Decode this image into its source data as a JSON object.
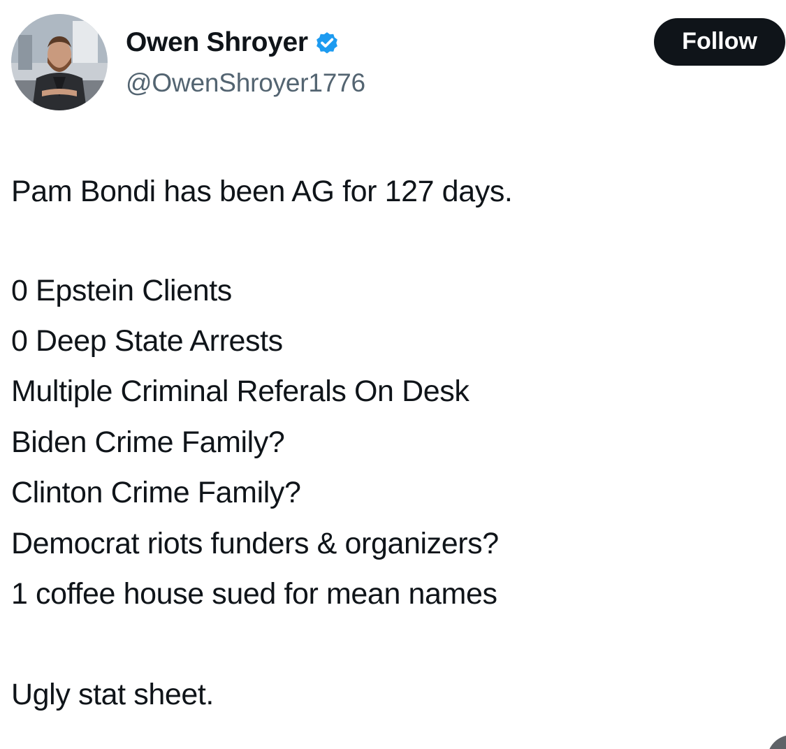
{
  "author": {
    "display_name": "Owen Shroyer",
    "handle": "@OwenShroyer1776",
    "verified_badge_color": "#1d9bf0"
  },
  "actions": {
    "follow_label": "Follow"
  },
  "tweet": {
    "lines": [
      "Pam Bondi has been AG for 127 days.",
      "0 Epstein Clients",
      "0 Deep State Arrests",
      "Multiple Criminal Referals On Desk",
      "Biden Crime Family?",
      "Clinton Crime Family?",
      "Democrat riots funders & organizers?",
      "1 coffee house sued for mean names",
      "Ugly stat sheet."
    ]
  },
  "icons": {
    "verified": "verified-badge-icon",
    "avatar": "profile-photo"
  }
}
